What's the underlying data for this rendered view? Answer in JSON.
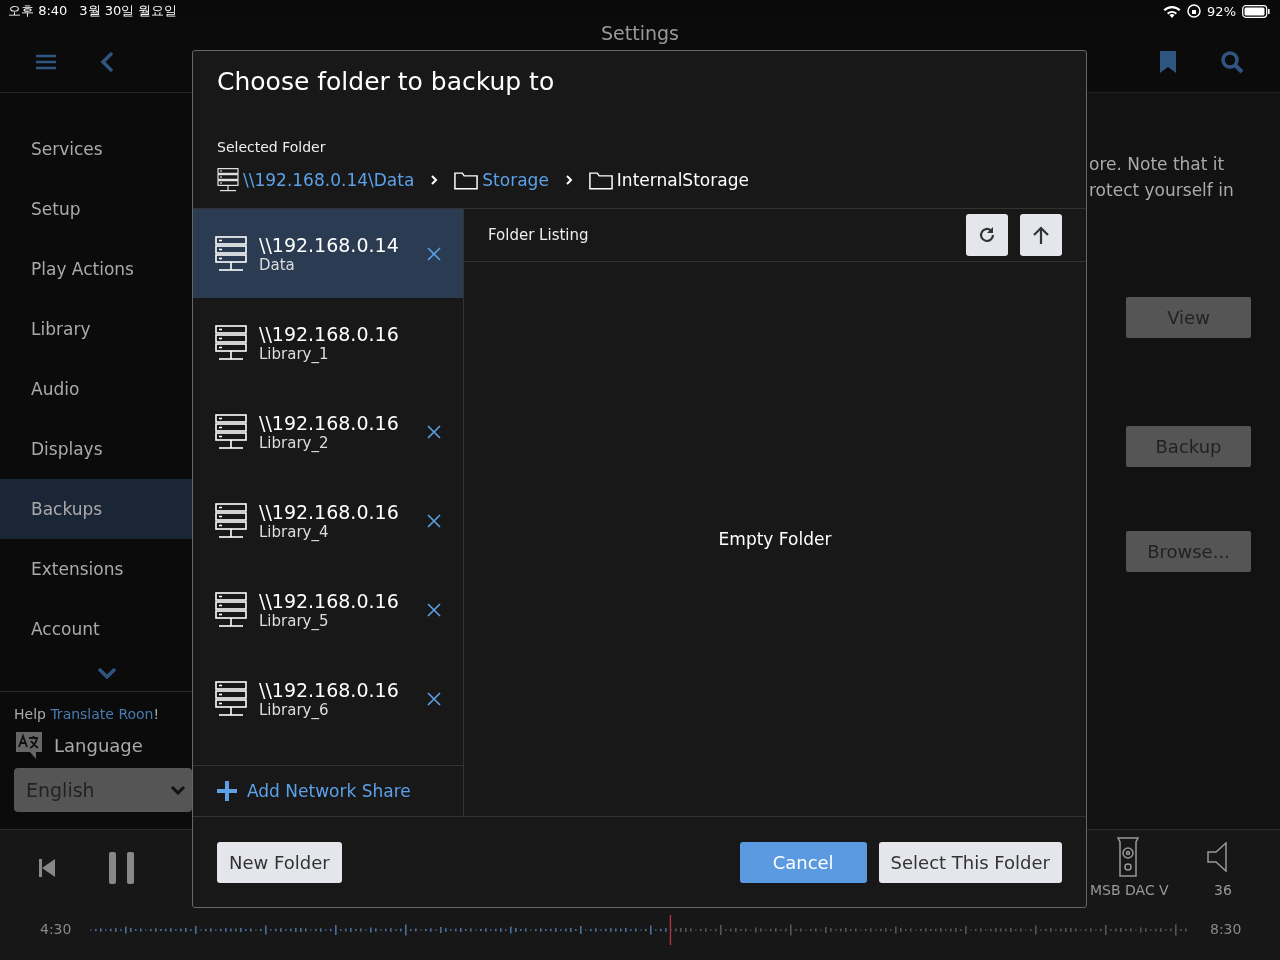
{
  "status_bar": {
    "time": "오후 8:40",
    "date": "3월 30일 월요일",
    "battery": "92%"
  },
  "header": {
    "title": "Settings"
  },
  "sidebar": {
    "items": [
      {
        "label": "Services",
        "selected": false
      },
      {
        "label": "Setup",
        "selected": false
      },
      {
        "label": "Play Actions",
        "selected": false
      },
      {
        "label": "Library",
        "selected": false
      },
      {
        "label": "Audio",
        "selected": false
      },
      {
        "label": "Displays",
        "selected": false
      },
      {
        "label": "Backups",
        "selected": true
      },
      {
        "label": "Extensions",
        "selected": false
      },
      {
        "label": "Account",
        "selected": false
      }
    ],
    "help_prefix": "Help ",
    "help_link": "Translate Roon",
    "help_suffix": "!",
    "language_label": "Language",
    "language_value": "English"
  },
  "content": {
    "text_lines": [
      "ore. Note that it",
      "rotect yourself in"
    ],
    "buttons": [
      "View",
      "Backup",
      "Browse..."
    ]
  },
  "player": {
    "zone": "MSB DAC V",
    "volume": "36",
    "elapsed": "4:30",
    "total": "8:30",
    "level": 0.528
  },
  "dialog": {
    "title": "Choose folder to backup to",
    "selected_folder_label": "Selected Folder",
    "breadcrumb": [
      {
        "kind": "server",
        "label": "\\\\192.168.0.14\\Data",
        "current": false
      },
      {
        "kind": "folder",
        "label": "Storage",
        "current": false
      },
      {
        "kind": "folder",
        "label": "InternalStorage",
        "current": true
      }
    ],
    "shares": [
      {
        "host": "\\\\192.168.0.14",
        "name": "Data",
        "selected": true,
        "removable": true
      },
      {
        "host": "\\\\192.168.0.16",
        "name": "Library_1",
        "selected": false,
        "removable": false
      },
      {
        "host": "\\\\192.168.0.16",
        "name": "Library_2",
        "selected": false,
        "removable": true
      },
      {
        "host": "\\\\192.168.0.16",
        "name": "Library_4",
        "selected": false,
        "removable": true
      },
      {
        "host": "\\\\192.168.0.16",
        "name": "Library_5",
        "selected": false,
        "removable": true
      },
      {
        "host": "\\\\192.168.0.16",
        "name": "Library_6",
        "selected": false,
        "removable": true
      }
    ],
    "add_share": "Add Network Share",
    "listing_title": "Folder Listing",
    "empty_text": "Empty Folder",
    "buttons": [
      {
        "kind": "secondary",
        "label": "New Folder"
      },
      {
        "kind": "primary",
        "label": "Cancel"
      },
      {
        "kind": "secondary",
        "label": "Select This Folder"
      }
    ]
  }
}
